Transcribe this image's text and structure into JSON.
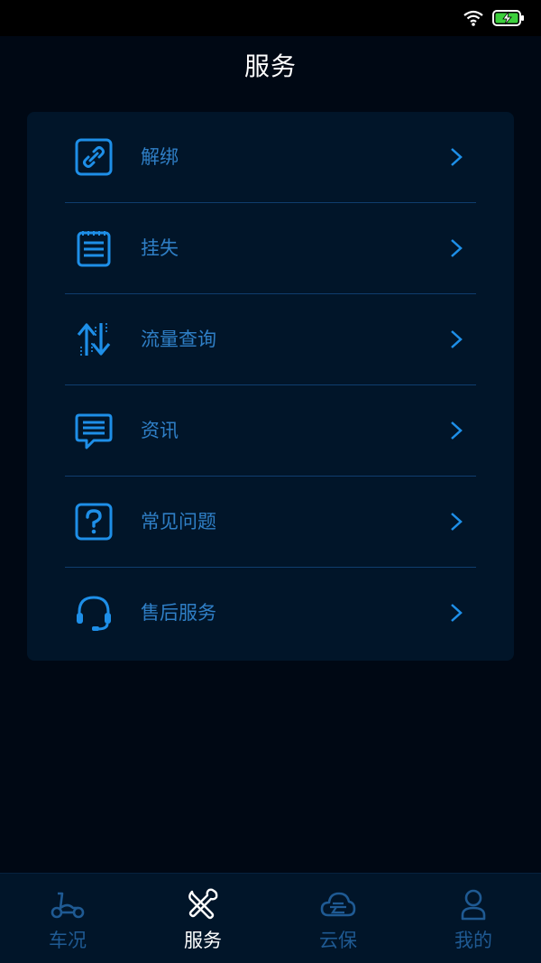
{
  "page": {
    "title": "服务"
  },
  "colors": {
    "accent": "#1e8fe8",
    "label": "#2f7fc6",
    "inactive_tab": "#1f5a93",
    "active_tab": "#ffffff",
    "card_bg": "#011529",
    "page_bg": "#000814"
  },
  "menu": [
    {
      "label": "解绑",
      "icon": "unlink-icon"
    },
    {
      "label": "挂失",
      "icon": "notepad-icon"
    },
    {
      "label": "流量查询",
      "icon": "data-transfer-icon"
    },
    {
      "label": "资讯",
      "icon": "message-icon"
    },
    {
      "label": "常见问题",
      "icon": "question-icon"
    },
    {
      "label": "售后服务",
      "icon": "headset-icon"
    }
  ],
  "tabs": [
    {
      "label": "车况",
      "icon": "scooter-icon",
      "active": false
    },
    {
      "label": "服务",
      "icon": "tools-icon",
      "active": true
    },
    {
      "label": "云保",
      "icon": "cloud-icon",
      "active": false
    },
    {
      "label": "我的",
      "icon": "user-icon",
      "active": false
    }
  ]
}
